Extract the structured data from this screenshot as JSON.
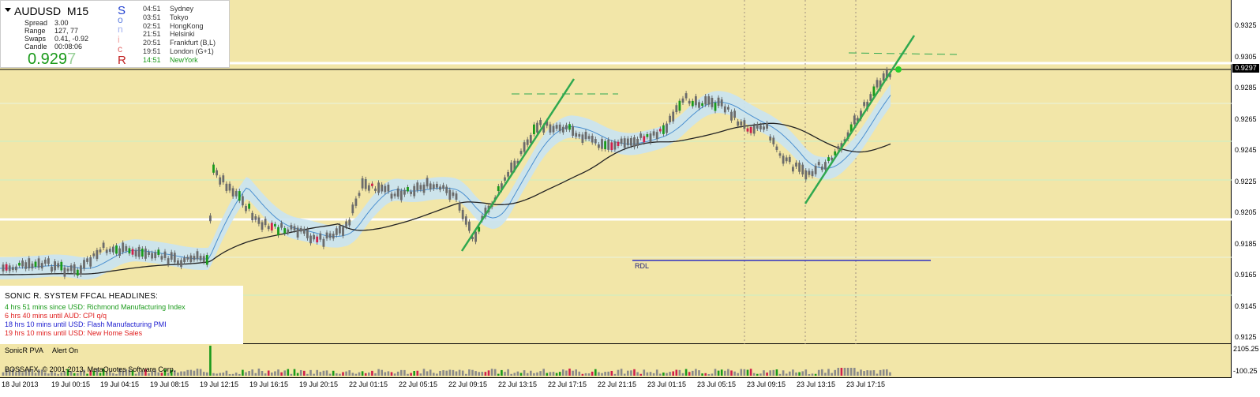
{
  "window": {
    "symbol": "AUDUSD",
    "timeframe": "M15"
  },
  "info": {
    "spread_label": "Spread",
    "spread_value": "3.00",
    "range_label": "Range",
    "range_value": "127, 77",
    "swaps_label": "Swaps",
    "swaps_value": "0.41, -0.92",
    "candle_label": "Candle",
    "candle_value": "00:08:06",
    "bid_main": "0.929",
    "bid_last": "7"
  },
  "sonic_letters": [
    {
      "ch": "S",
      "color": "#2040d0"
    },
    {
      "ch": "o",
      "color": "#6080e0"
    },
    {
      "ch": "n",
      "color": "#a0b0f0"
    },
    {
      "ch": "i",
      "color": "#f0a0a0"
    },
    {
      "ch": "c",
      "color": "#e06060"
    },
    {
      "ch": "R",
      "color": "#c02020"
    }
  ],
  "sessions": [
    {
      "time": "04:51",
      "city": "Sydney",
      "color": "#333333"
    },
    {
      "time": "03:51",
      "city": "Tokyo",
      "color": "#333333"
    },
    {
      "time": "02:51",
      "city": "HongKong",
      "color": "#333333"
    },
    {
      "time": "21:51",
      "city": "Helsinki",
      "color": "#333333"
    },
    {
      "time": "20:51",
      "city": "Frankfurt  (B,L)",
      "color": "#333333"
    },
    {
      "time": "19:51",
      "city": "London  (G+1)",
      "color": "#333333"
    },
    {
      "time": "14:51",
      "city": "NewYork",
      "color": "#1a9a1a"
    }
  ],
  "price_axis": [
    "0.9325",
    "0.9305",
    "0.9285",
    "0.9265",
    "0.9245",
    "0.9225",
    "0.9205",
    "0.9185",
    "0.9165",
    "0.9145",
    "0.9125"
  ],
  "current_price": "0.9297",
  "indicator_axis": {
    "top": "2105.25",
    "bottom": "-100.25"
  },
  "indicator": {
    "name": "SonicR PVA",
    "alert": "Alert On",
    "copyright": "BOSSAFX, © 2001-2013, MetaQuotes Software Corp."
  },
  "rdl_label": "RDL",
  "headlines": {
    "title": "SONIC R. SYSTEM  FFCAL HEADLINES:",
    "items": [
      {
        "text": "4 hrs 51 mins since USD: Richmond Manufacturing Index",
        "color": "#1a9a1a"
      },
      {
        "text": "6 hrs 40 mins until AUD: CPI q/q",
        "color": "#e02020"
      },
      {
        "text": "18 hrs 10 mins until USD: Flash Manufacturing PMI",
        "color": "#2020d0"
      },
      {
        "text": "19 hrs 10 mins until USD: New Home Sales",
        "color": "#e02020"
      }
    ]
  },
  "time_axis": [
    "18 Jul 2013",
    "19 Jul 00:15",
    "19 Jul 04:15",
    "19 Jul 08:15",
    "19 Jul 12:15",
    "19 Jul 16:15",
    "19 Jul 20:15",
    "22 Jul 01:15",
    "22 Jul 05:15",
    "22 Jul 09:15",
    "22 Jul 13:15",
    "22 Jul 17:15",
    "22 Jul 21:15",
    "23 Jul 01:15",
    "23 Jul 05:15",
    "23 Jul 09:15",
    "23 Jul 13:15",
    "23 Jul 17:15"
  ],
  "colors": {
    "background": "#f2e6a8",
    "bull": "#1a9a1a",
    "bear": "#d0204a",
    "neutral": "#6b6b6b",
    "band": "#c9e3f2",
    "ma": "#222222",
    "trend": "#2fa84f"
  }
}
